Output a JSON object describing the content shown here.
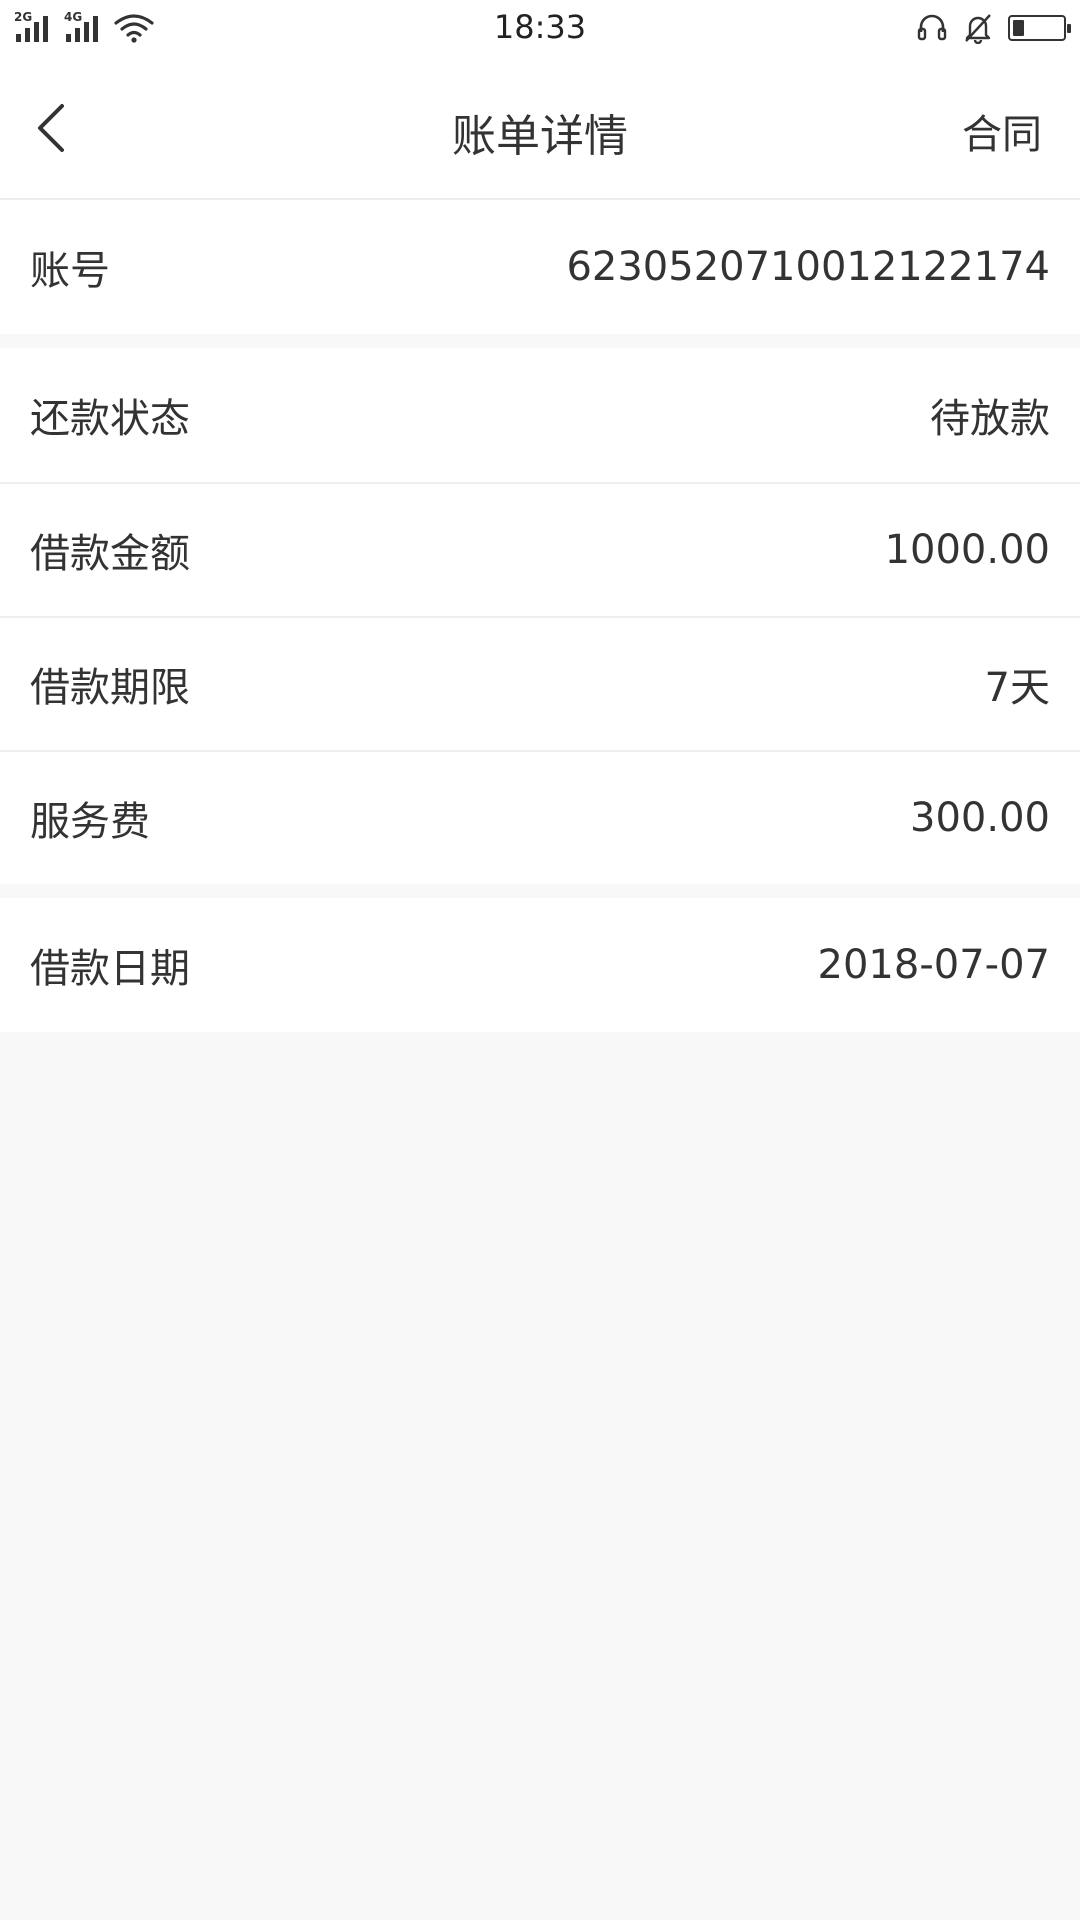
{
  "status_bar": {
    "time": "18:33",
    "signal_left": "2G",
    "signal_right": "4G",
    "battery_level": 0.22,
    "icons": [
      "headset-icon",
      "bell-muted-icon",
      "battery-icon",
      "wifi-icon"
    ]
  },
  "nav": {
    "title": "账单详情",
    "back_icon": "chevron-left-icon",
    "action_label": "合同"
  },
  "sections": {
    "account": {
      "label": "账号",
      "value": "6230520710012122174"
    },
    "status": {
      "label": "还款状态",
      "value": "待放款"
    },
    "amount": {
      "label": "借款金额",
      "value": "1000.00"
    },
    "term": {
      "label": "借款期限",
      "value": "7天"
    },
    "fee": {
      "label": "服务费",
      "value": "300.00"
    },
    "date": {
      "label": "借款日期",
      "value": "2018-07-07"
    }
  },
  "colors": {
    "page_background": "#f8f8f8",
    "card_background": "#ffffff",
    "text": "#333333",
    "divider": "#efefef",
    "section_gap": "#ececec"
  }
}
